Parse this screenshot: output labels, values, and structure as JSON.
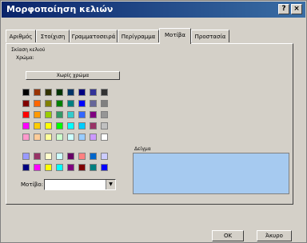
{
  "window": {
    "title": "Μορφοποίηση κελιών",
    "help_label": "?",
    "close_label": "×"
  },
  "tabs": [
    {
      "label": "Αριθμός",
      "active": false
    },
    {
      "label": "Στοίχιση",
      "active": false
    },
    {
      "label": "Γραμματοσειρά",
      "active": false
    },
    {
      "label": "Περίγραμμα",
      "active": false
    },
    {
      "label": "Μοτίβα",
      "active": true
    },
    {
      "label": "Προστασία",
      "active": false
    }
  ],
  "patterns": {
    "group_label": "Σκίαση κελιού",
    "color_label": "Χρώμα:",
    "no_color_label": "Χωρίς χρώμα",
    "pattern_label": "Μοτίβο:",
    "pattern_value": "",
    "preview_label": "Δείγμα",
    "preview_color": "#a6caf0",
    "palette_top": [
      [
        "#000000",
        "#993300",
        "#333300",
        "#003300",
        "#003366",
        "#000080",
        "#333399",
        "#333333"
      ],
      [
        "#800000",
        "#FF6600",
        "#808000",
        "#008000",
        "#008080",
        "#0000FF",
        "#666699",
        "#808080"
      ],
      [
        "#FF0000",
        "#FF9900",
        "#99CC00",
        "#339966",
        "#33CCCC",
        "#3366FF",
        "#800080",
        "#969696"
      ],
      [
        "#FF00FF",
        "#FFCC00",
        "#FFFF00",
        "#00FF00",
        "#00FFFF",
        "#00CCFF",
        "#993366",
        "#C0C0C0"
      ],
      [
        "#FF99CC",
        "#FFCC99",
        "#FFFF99",
        "#CCFFCC",
        "#CCFFFF",
        "#99CCFF",
        "#CC99FF",
        "#FFFFFF"
      ]
    ],
    "palette_bottom": [
      [
        "#9999FF",
        "#993366",
        "#FFFFCC",
        "#CCFFFF",
        "#660066",
        "#FF8080",
        "#0066CC",
        "#CCCCFF"
      ],
      [
        "#000080",
        "#FF00FF",
        "#FFFF00",
        "#00FFFF",
        "#800080",
        "#800000",
        "#008080",
        "#0000FF"
      ]
    ]
  },
  "buttons": {
    "ok_label": "OK",
    "cancel_label": "Άκυρο"
  }
}
